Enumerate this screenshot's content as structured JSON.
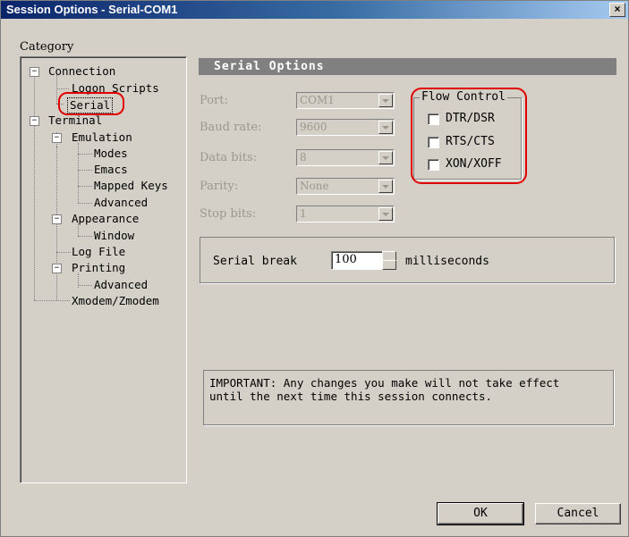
{
  "window": {
    "title": "Session Options - Serial-COM1",
    "close_label": "×"
  },
  "category": {
    "label": "Category"
  },
  "tree": [
    {
      "label": "Connection",
      "expander": "−"
    },
    {
      "label": "Logon Scripts"
    },
    {
      "label": "Serial"
    },
    {
      "label": "Terminal",
      "expander": "−"
    },
    {
      "label": "Emulation",
      "expander": "−"
    },
    {
      "label": "Modes"
    },
    {
      "label": "Emacs"
    },
    {
      "label": "Mapped Keys"
    },
    {
      "label": "Advanced"
    },
    {
      "label": "Appearance",
      "expander": "−"
    },
    {
      "label": "Window"
    },
    {
      "label": "Log File"
    },
    {
      "label": "Printing",
      "expander": "−"
    },
    {
      "label": "Advanced"
    },
    {
      "label": "Xmodem/Zmodem"
    }
  ],
  "panel": {
    "title": "Serial Options"
  },
  "serial": {
    "port_label": "Port:",
    "port_value": "COM1",
    "baud_label": "Baud rate:",
    "baud_value": "9600",
    "data_label": "Data bits:",
    "data_value": "8",
    "parity_label": "Parity:",
    "parity_value": "None",
    "stop_label": "Stop bits:",
    "stop_value": "1"
  },
  "flow_control": {
    "title": "Flow Control",
    "options": [
      {
        "label": "DTR/DSR",
        "checked": false
      },
      {
        "label": "RTS/CTS",
        "checked": false
      },
      {
        "label": "XON/XOFF",
        "checked": false
      }
    ]
  },
  "serial_break": {
    "label": "Serial break",
    "value": "100",
    "unit": "milliseconds"
  },
  "note": "IMPORTANT: Any changes you make will not take effect\nuntil the next time this session connects.",
  "buttons": {
    "ok": "OK",
    "cancel": "Cancel"
  },
  "colors": {
    "highlight": "#e00000",
    "title_bar": "#0a246a",
    "disabled_text": "#9b978f"
  }
}
